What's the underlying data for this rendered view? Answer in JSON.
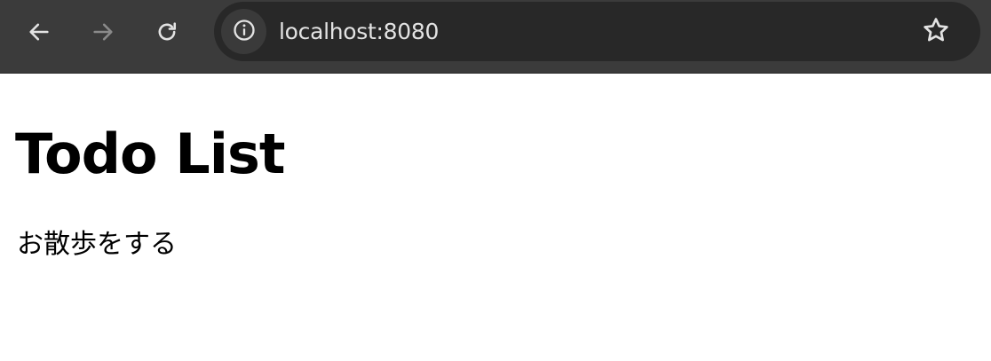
{
  "browser": {
    "url": "localhost:8080",
    "icons": {
      "back": "arrow-left-icon",
      "forward": "arrow-right-icon",
      "reload": "reload-icon",
      "site_info": "info-icon",
      "bookmark": "star-icon"
    },
    "colors": {
      "toolbar": "#3b3b3b",
      "omnibox": "#282828",
      "icon": "#e3e3e3",
      "icon_disabled": "#8a8a8a"
    }
  },
  "page": {
    "title": "Todo List",
    "todos": [
      "お散歩をする"
    ]
  }
}
